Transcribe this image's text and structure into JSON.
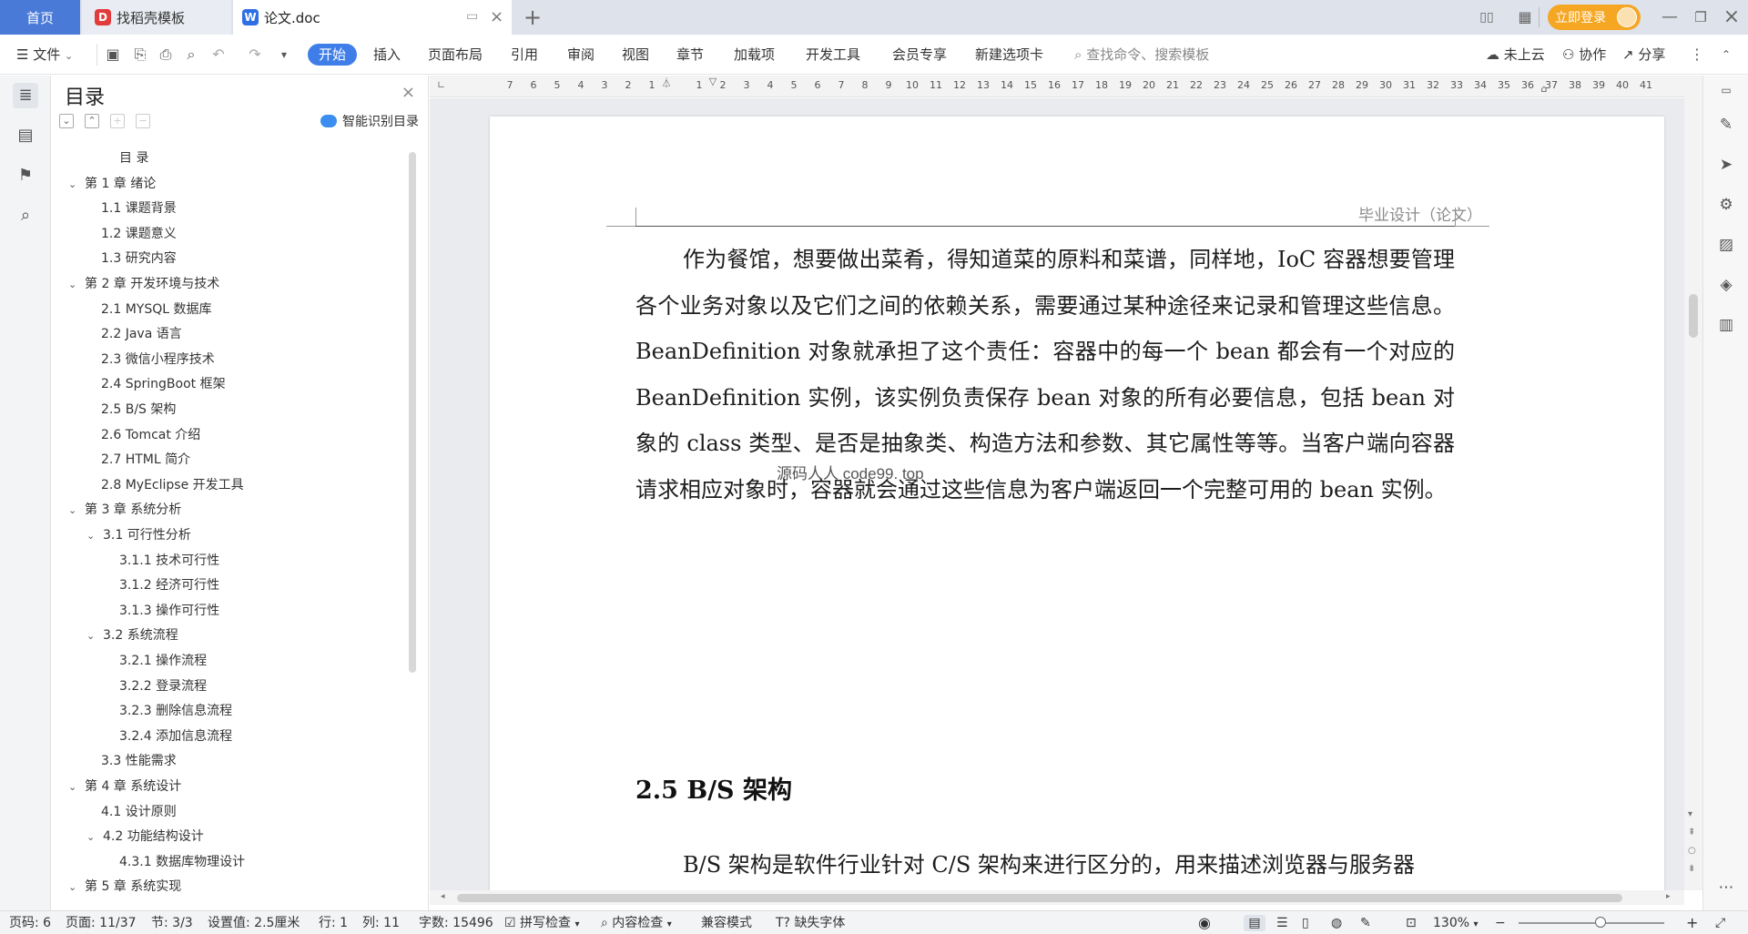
{
  "titlebar": {
    "tabs": [
      {
        "label": "首页"
      },
      {
        "label": "找稻壳模板"
      },
      {
        "label": "论文.doc"
      }
    ],
    "login_label": "立即登录"
  },
  "toolbar": {
    "file_label": "文件",
    "menus": [
      "开始",
      "插入",
      "页面布局",
      "引用",
      "审阅",
      "视图",
      "章节",
      "加载项",
      "开发工具",
      "会员专享",
      "新建选项卡"
    ],
    "search_placeholder": "查找命令、搜索模板",
    "cloud_label": "未上云",
    "collab_label": "协作",
    "share_label": "分享"
  },
  "outline": {
    "title": "目录",
    "smart_label": "智能识别目录",
    "items": [
      {
        "text": "目  录",
        "level": 0,
        "arrow": ""
      },
      {
        "text": "第 1 章  绪论",
        "level": 0,
        "arrow": "v"
      },
      {
        "text": "1.1  课题背景",
        "level": 1,
        "arrow": ""
      },
      {
        "text": "1.2  课题意义",
        "level": 1,
        "arrow": ""
      },
      {
        "text": "1.3  研究内容",
        "level": 1,
        "arrow": ""
      },
      {
        "text": "第 2 章  开发环境与技术",
        "level": 0,
        "arrow": "v"
      },
      {
        "text": "2.1 MYSQL 数据库",
        "level": 1,
        "arrow": ""
      },
      {
        "text": "2.2 Java 语言",
        "level": 1,
        "arrow": ""
      },
      {
        "text": "2.3  微信小程序技术",
        "level": 1,
        "arrow": ""
      },
      {
        "text": "2.4 SpringBoot 框架",
        "level": 1,
        "arrow": ""
      },
      {
        "text": "2.5 B/S 架构",
        "level": 1,
        "arrow": ""
      },
      {
        "text": "2.6 Tomcat  介绍",
        "level": 1,
        "arrow": ""
      },
      {
        "text": "2.7 HTML 简介",
        "level": 1,
        "arrow": ""
      },
      {
        "text": "2.8 MyEclipse 开发工具",
        "level": 1,
        "arrow": ""
      },
      {
        "text": "第 3 章  系统分析",
        "level": 0,
        "arrow": "v"
      },
      {
        "text": "3.1  可行性分析",
        "level": 1,
        "arrow": "v"
      },
      {
        "text": "3.1.1  技术可行性",
        "level": 2,
        "arrow": ""
      },
      {
        "text": "3.1.2  经济可行性",
        "level": 2,
        "arrow": ""
      },
      {
        "text": "3.1.3  操作可行性",
        "level": 2,
        "arrow": ""
      },
      {
        "text": "3.2  系统流程",
        "level": 1,
        "arrow": "v"
      },
      {
        "text": "3.2.1  操作流程",
        "level": 2,
        "arrow": ""
      },
      {
        "text": "3.2.2  登录流程",
        "level": 2,
        "arrow": ""
      },
      {
        "text": "3.2.3  删除信息流程",
        "level": 2,
        "arrow": ""
      },
      {
        "text": "3.2.4  添加信息流程",
        "level": 2,
        "arrow": ""
      },
      {
        "text": "3.3  性能需求",
        "level": 1,
        "arrow": ""
      },
      {
        "text": "第 4 章  系统设计",
        "level": 0,
        "arrow": "v"
      },
      {
        "text": "4.1  设计原则",
        "level": 1,
        "arrow": ""
      },
      {
        "text": "4.2  功能结构设计",
        "level": 1,
        "arrow": "v"
      },
      {
        "text": "4.3.1  数据库物理设计",
        "level": 2,
        "arrow": ""
      },
      {
        "text": "第 5 章  系统实现",
        "level": 0,
        "arrow": "v"
      }
    ]
  },
  "ruler": {
    "numbers": [
      "7",
      "6",
      "5",
      "4",
      "3",
      "2",
      "1",
      "",
      "1",
      "2",
      "3",
      "4",
      "5",
      "6",
      "7",
      "8",
      "9",
      "10",
      "11",
      "12",
      "13",
      "14",
      "15",
      "16",
      "17",
      "18",
      "19",
      "20",
      "21",
      "22",
      "23",
      "24",
      "25",
      "26",
      "27",
      "28",
      "29",
      "30",
      "31",
      "32",
      "33",
      "34",
      "35",
      "36",
      "37",
      "38",
      "39",
      "40",
      "41"
    ]
  },
  "document": {
    "header": "毕业设计（论文）",
    "paragraph1": "作为餐馆，想要做出菜肴，得知道菜的原料和菜谱，同样地，IoC 容器想要管理各个业务对象以及它们之间的依赖关系，需要通过某种途径来记录和管理这些信息。BeanDefinition 对象就承担了这个责任：容器中的每一个 bean 都会有一个对应的 BeanDefinition 实例，该实例负责保存 bean 对象的所有必要信息，包括 bean 对象的 class 类型、是否是抽象类、构造方法和参数、其它属性等等。当客户端向容器请求相应对象时，容器就会通过这些信息为客户端返回一个完整可用的 bean 实例。",
    "watermark": "源码人人 code99. top",
    "heading": "2.5 B/S 架构",
    "paragraph2": "B/S 架构是软件行业针对 C/S 架构来进行区分的，用来描述浏览器与服务器"
  },
  "statusbar": {
    "page_code": "页码: 6",
    "page": "页面: 11/37",
    "section": "节: 3/3",
    "setting": "设置值: 2.5厘米",
    "row": "行: 1",
    "col": "列: 11",
    "wordcount": "字数: 15496",
    "spell": "拼写检查",
    "content_check": "内容检查",
    "compat": "兼容模式",
    "missing_font": "缺失字体",
    "zoom": "130%"
  }
}
